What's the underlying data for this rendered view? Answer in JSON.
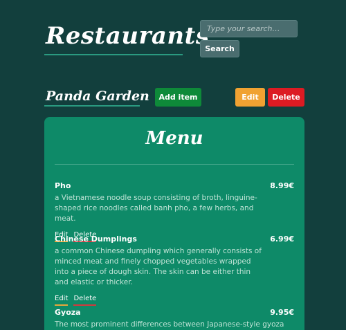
{
  "header": {
    "title": "Restaurants",
    "search_placeholder": "Type your search…",
    "search_label": "Search"
  },
  "restaurant": {
    "name": "Panda Garden",
    "add_item_label": "Add item",
    "edit_label": "Edit",
    "delete_label": "Delete"
  },
  "menu": {
    "title": "Menu",
    "items": [
      {
        "name": "Pho",
        "price": "8.99€",
        "description": "a Vietnamese noodle soup consisting of broth, linguine-shaped rice noodles called banh pho, a few herbs, and meat.",
        "edit_label": "Edit",
        "delete_label": "Delete"
      },
      {
        "name": "Chinese Dumplings",
        "price": "6.99€",
        "description": "a common Chinese dumpling which generally consists of minced meat and finely chopped vegetables wrapped into a piece of dough skin. The skin can be either thin and elastic or thicker.",
        "edit_label": "Edit",
        "delete_label": "Delete"
      },
      {
        "name": "Gyoza",
        "price": "9.95€",
        "description": "The most prominent differences between Japanese-style gyoza"
      }
    ]
  },
  "colors": {
    "background": "#123f3d",
    "card": "#0e8a68",
    "add_button": "#0e8a39",
    "edit_button": "#f0a232",
    "delete_button": "#dc1b23"
  }
}
